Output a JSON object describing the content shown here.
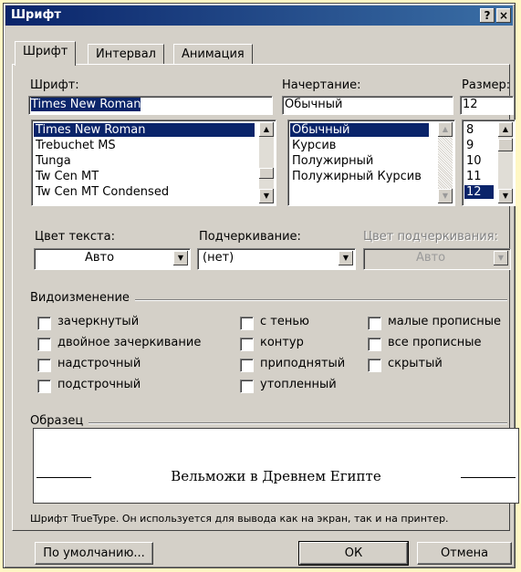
{
  "window": {
    "title": "Шрифт",
    "help_btn": "?",
    "close_btn": "×"
  },
  "tabs": [
    {
      "label": "Шрифт"
    },
    {
      "label": "Интервал"
    },
    {
      "label": "Анимация"
    }
  ],
  "font": {
    "label": "Шрифт:",
    "value": "Times New Roman",
    "items": [
      "Times New Roman",
      "Trebuchet MS",
      "Tunga",
      "Tw Cen MT",
      "Tw Cen MT Condensed"
    ],
    "selected": "Times New Roman"
  },
  "style": {
    "label": "Начертание:",
    "value": "Обычный",
    "items": [
      "Обычный",
      "Курсив",
      "Полужирный",
      "Полужирный Курсив"
    ],
    "selected": "Обычный"
  },
  "size": {
    "label": "Размер:",
    "value": "12",
    "items": [
      "8",
      "9",
      "10",
      "11",
      "12"
    ],
    "selected": "12"
  },
  "color": {
    "label": "Цвет текста:",
    "value": "Авто"
  },
  "underline": {
    "label": "Подчеркивание:",
    "value": "(нет)"
  },
  "underline_color": {
    "label": "Цвет подчеркивания:",
    "value": "Авто"
  },
  "effects": {
    "label": "Видоизменение",
    "col1": [
      {
        "label": "зачеркнутый",
        "checked": false
      },
      {
        "label": "двойное зачеркивание",
        "checked": false
      },
      {
        "label": "надстрочный",
        "checked": false
      },
      {
        "label": "подстрочный",
        "checked": false
      }
    ],
    "col2": [
      {
        "label": "с тенью",
        "checked": false
      },
      {
        "label": "контур",
        "checked": false
      },
      {
        "label": "приподнятый",
        "checked": false
      },
      {
        "label": "утопленный",
        "checked": false
      }
    ],
    "col3": [
      {
        "label": "малые прописные",
        "checked": false
      },
      {
        "label": "все прописные",
        "checked": false
      },
      {
        "label": "скрытый",
        "checked": false
      }
    ]
  },
  "preview": {
    "label": "Образец",
    "sample": "Вельможи в Древнем Египте",
    "note": "Шрифт TrueType. Он используется для вывода как на экран, так и на принтер."
  },
  "buttons": {
    "default": "По умолчанию...",
    "ok": "ОК",
    "cancel": "Отмена"
  }
}
